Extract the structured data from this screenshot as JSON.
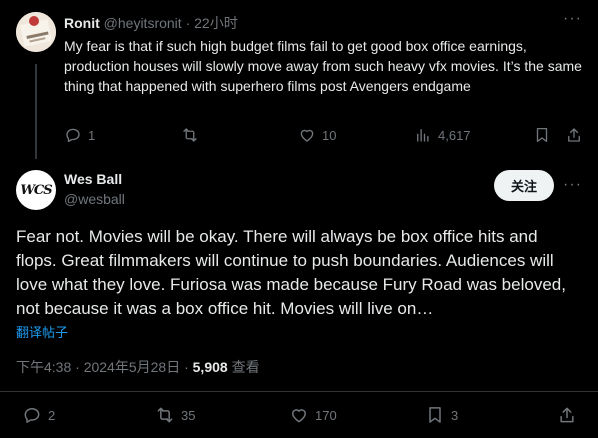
{
  "reply_tweet": {
    "display_name": "Ronit",
    "handle": "@heyitsronit",
    "separator": "·",
    "time": "22小时",
    "text": "My fear is that if such high budget films fail to get good box office earnings, production houses will slowly move away from such heavy vfx movies. It’s the same thing that happened with superhero films post Avengers endgame",
    "more": "···",
    "stats": {
      "replies": "1",
      "retweets": "",
      "likes": "10",
      "views": "4,617"
    }
  },
  "main_tweet": {
    "display_name": "Wes Ball",
    "handle": "@wesball",
    "avatar_text": "WCS",
    "follow_label": "关注",
    "more": "···",
    "text": "Fear not. Movies will be okay. There will always be box office hits and flops. Great filmmakers will continue to push boundaries. Audiences will love what they love. Furiosa was made because Fury Road was beloved, not because it was a box office hit. Movies will live on…",
    "translate_label": "翻译帖子",
    "timestamp": "下午4:38 · 2024年5月28日 ·",
    "views_count": "5,908",
    "views_label": "查看",
    "stats": {
      "replies": "2",
      "retweets": "35",
      "likes": "170",
      "bookmarks": "3"
    }
  },
  "colors": {
    "background": "#000000",
    "text": "#e7e9ea",
    "muted": "#71767b",
    "link": "#1d9bf0",
    "divider": "#2f3336"
  }
}
